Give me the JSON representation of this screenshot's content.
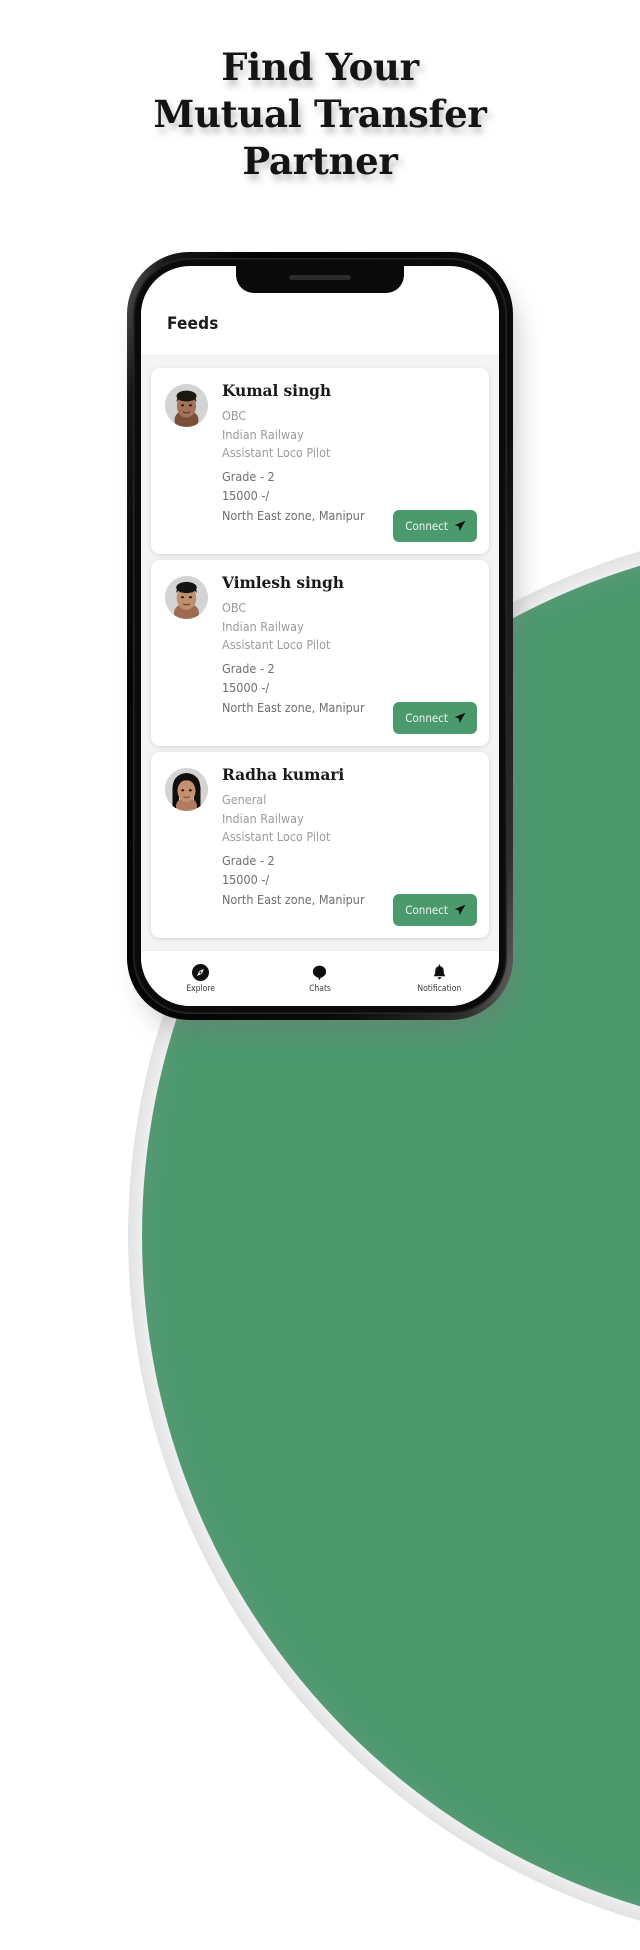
{
  "headline": {
    "line1": "Find Your",
    "line2": "Mutual Transfer",
    "line3": "Partner"
  },
  "colors": {
    "brand_green": "#4b9a6e",
    "button_green": "#4a9a6d",
    "feed_background": "#f4f4f4",
    "card_background": "#ffffff",
    "meta_light": "#9b9b9b",
    "meta_dark": "#6f6f6f"
  },
  "app": {
    "header": {
      "title": "Feeds"
    },
    "feed": {
      "cards": [
        {
          "name": "Kumal singh",
          "category": "OBC",
          "organization": "Indian Railway",
          "designation": "Assistant Loco Pilot",
          "grade": "Grade - 2",
          "salary": "15000 -/",
          "location": "North East zone, Manipur",
          "action_label": "Connect",
          "avatar": "male-avatar-1"
        },
        {
          "name": "Vimlesh singh",
          "category": "OBC",
          "organization": "Indian Railway",
          "designation": "Assistant Loco Pilot",
          "grade": "Grade - 2",
          "salary": "15000 -/",
          "location": "North East zone, Manipur",
          "action_label": "Connect",
          "avatar": "male-avatar-2"
        },
        {
          "name": "Radha kumari",
          "category": "General",
          "organization": "Indian Railway",
          "designation": "Assistant Loco Pilot",
          "grade": "Grade - 2",
          "salary": "15000 -/",
          "location": "North East zone, Manipur",
          "action_label": "Connect",
          "avatar": "female-avatar-1"
        }
      ]
    },
    "bottom_nav": {
      "items": [
        {
          "label": "Explore",
          "icon": "compass-icon"
        },
        {
          "label": "Chats",
          "icon": "chat-bubble-icon"
        },
        {
          "label": "Notification",
          "icon": "bell-icon"
        }
      ]
    }
  }
}
